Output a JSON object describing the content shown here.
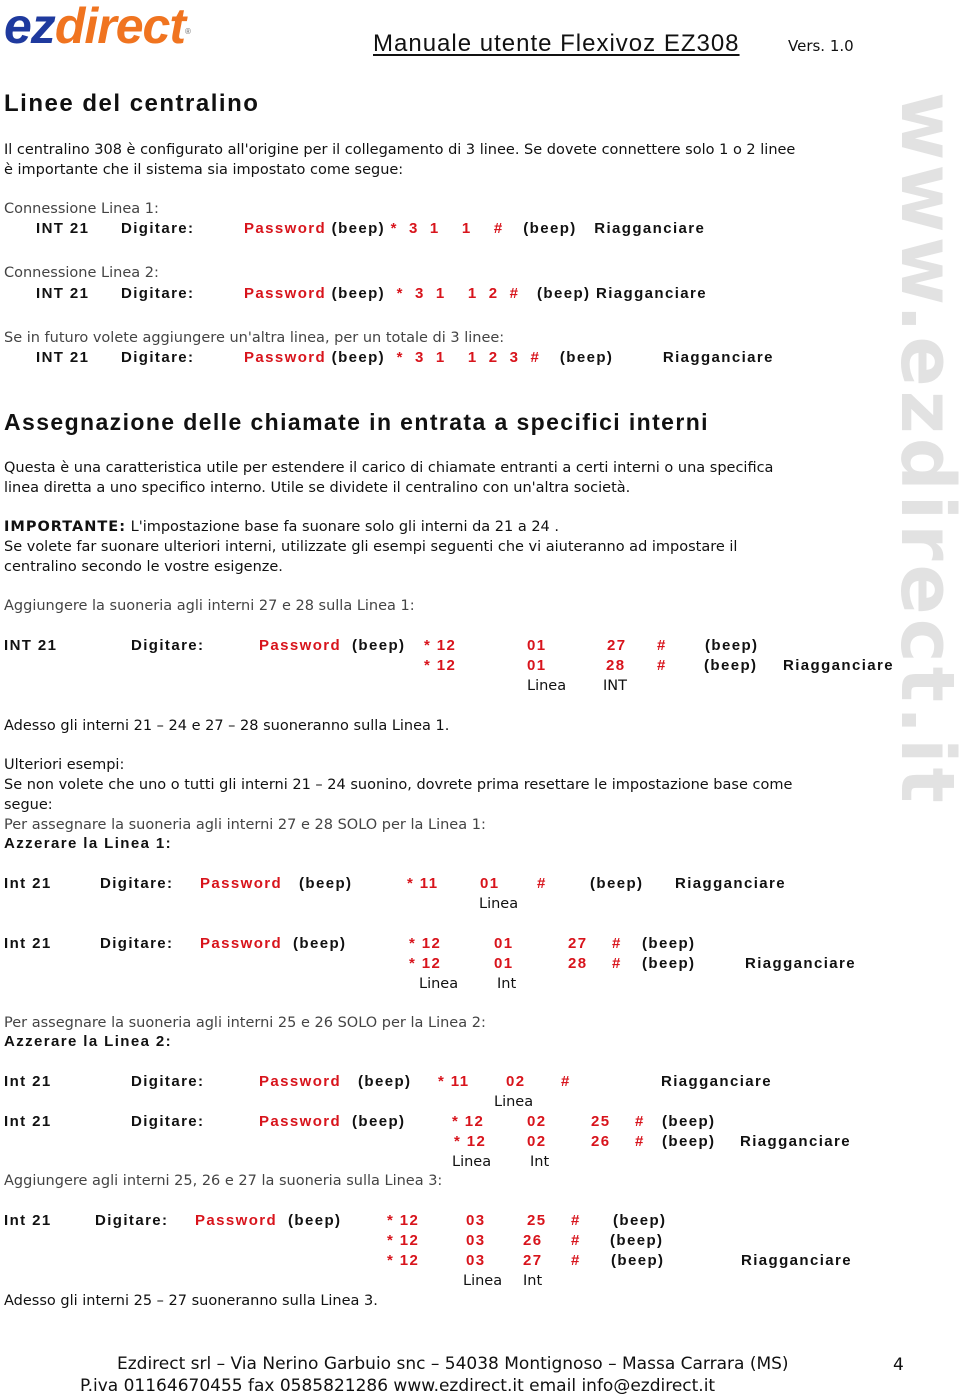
{
  "header": {
    "logo_part1": "ez",
    "logo_part2": "direct",
    "logo_reg": "®",
    "title": "Manuale utente Flexivoz EZ308",
    "version": "Vers. 1.0"
  },
  "watermark": "www.ezdirect.it",
  "section1": {
    "heading": "Linee del centralino",
    "intro_line1": "Il centralino 308 è configurato all'origine per il collegamento di 3 linee. Se dovete connettere solo 1 o 2 linee",
    "intro_line2": "è importante che il sistema sia impostato come segue:",
    "conn1_label": "Connessione Linea 1:",
    "conn2_label": "Connessione Linea 2:",
    "future_label": "Se in futuro volete aggiungere un'altra linea, per un totale di 3 linee:",
    "rows": [
      {
        "int": "INT 21",
        "digitare": "Digitare:",
        "password": "Password",
        "beep1": "(beep)",
        "code": "*  3  1    1    #",
        "beep2": "(beep)",
        "end": "Riagganciare"
      },
      {
        "int": "INT 21",
        "digitare": "Digitare:",
        "password": "Password",
        "beep1": "(beep)",
        "code": "*  3  1    1  2  #",
        "beep2": "(beep)",
        "end": "Riagganciare"
      },
      {
        "int": "INT 21",
        "digitare": "Digitare:",
        "password": "Password",
        "beep1": "(beep)",
        "code": "*  3  1    1  2  3  #",
        "beep2": "(beep)",
        "end": "Riagganciare"
      }
    ]
  },
  "section2": {
    "heading": "Assegnazione delle chiamate in entrata a specifici interni",
    "para1_line1": "Questa è una caratteristica utile per estendere il carico di chiamate entranti a certi interni o una specifica",
    "para1_line2": "linea diretta a uno specifico interno. Utile se dividete il centralino con un'altra società.",
    "important_label": "IMPORTANTE:",
    "important_text": " L'impostazione base fa suonare solo gli interni da 21 a 24 .",
    "para2_line1": "Se volete far suonare ulteriori interni, utilizzate gli esempi seguenti che vi aiuteranno ad impostare il",
    "para2_line2": "centralino secondo le vostre esigenze.",
    "example1_label": "Aggiungere la suoneria agli interni 27 e 28 sulla Linea 1:",
    "example1": {
      "int": "INT 21",
      "digitare": "Digitare:",
      "password": "Password",
      "beep": "(beep)",
      "lines": [
        {
          "cmd": "* 12",
          "linea": "01",
          "int": "27",
          "hash": "#",
          "beep": "(beep)",
          "end": ""
        },
        {
          "cmd": "* 12",
          "linea": "01",
          "int": "28",
          "hash": "#",
          "beep": "(beep)",
          "end": "Riagganciare"
        }
      ],
      "col_linea": "Linea",
      "col_int": "INT"
    },
    "example1_result": "Adesso gli interni 21 – 24 e 27 – 28 suoneranno sulla Linea 1.",
    "more_label": "Ulteriori esempi:",
    "more_line1": "Se non volete che uno o tutti gli interni 21 – 24 suonino, dovrete prima resettare le impostazione base come",
    "more_line2": "segue:",
    "assign1_label": "Per assegnare la suoneria agli interni 27 e 28 SOLO per la Linea 1:",
    "reset1_label": "Azzerare la Linea 1:",
    "reset1": {
      "int": "Int 21",
      "digitare": "Digitare:",
      "password": "Password",
      "beep": "(beep)",
      "cmd": "* 11",
      "linea": "01",
      "hash": "#",
      "beep2": "(beep)",
      "end": "Riagganciare",
      "col_linea": "Linea"
    },
    "assign1": {
      "int": "Int 21",
      "digitare": "Digitare:",
      "password": "Password",
      "beep": "(beep)",
      "lines": [
        {
          "cmd": "* 12",
          "linea": "01",
          "int": "27",
          "hash": "#",
          "beep": "(beep)",
          "end": ""
        },
        {
          "cmd": "* 12",
          "linea": "01",
          "int": "28",
          "hash": "#",
          "beep": "(beep)",
          "end": "Riagganciare"
        }
      ],
      "col_linea": "Linea",
      "col_int": "Int"
    },
    "assign2_label": "Per assegnare la suoneria agli interni 25 e 26 SOLO per la Linea 2:",
    "reset2_label": "Azzerare la Linea 2:",
    "reset2": {
      "int": "Int 21",
      "digitare": "Digitare:",
      "password": "Password",
      "beep": "(beep)",
      "cmd": "* 11",
      "linea": "02",
      "hash": "#",
      "end": "Riagganciare",
      "col_linea": "Linea"
    },
    "assign2": {
      "int": "Int 21",
      "digitare": "Digitare:",
      "password": "Password",
      "beep": "(beep)",
      "lines": [
        {
          "cmd": "* 12",
          "linea": "02",
          "int": "25",
          "hash": "#",
          "beep": "(beep)",
          "end": ""
        },
        {
          "cmd": "* 12",
          "linea": "02",
          "int": "26",
          "hash": "#",
          "beep": "(beep)",
          "end": "Riagganciare"
        }
      ],
      "col_linea": "Linea",
      "col_int": "Int"
    },
    "assign3_label": "Aggiungere agli interni 25, 26 e 27 la suoneria sulla Linea 3:",
    "assign3": {
      "int": "Int 21",
      "digitare": "Digitare:",
      "password": "Password",
      "beep": "(beep)",
      "lines": [
        {
          "cmd": "* 12",
          "linea": "03",
          "int": "25",
          "hash": "#",
          "beep": "(beep)",
          "end": ""
        },
        {
          "cmd": "* 12",
          "linea": "03",
          "int": "26",
          "hash": "#",
          "beep": "(beep)",
          "end": ""
        },
        {
          "cmd": "* 12",
          "linea": "03",
          "int": "27",
          "hash": "#",
          "beep": "(beep)",
          "end": "Riagganciare"
        }
      ],
      "col_linea": "Linea",
      "col_int": "Int"
    },
    "assign3_result": "Adesso gli interni 25 – 27 suoneranno sulla Linea 3."
  },
  "footer": {
    "line1": "Ezdirect srl – Via Nerino Garbuio snc – 54038 Montignoso – Massa Carrara (MS)",
    "line2": "P.iva 01164670455  fax 0585821286  www.ezdirect.it  email info@ezdirect.it",
    "page_number": "4"
  },
  "colors": {
    "accent_red": "#d8141c",
    "logo_blue": "#1f3a9e",
    "logo_orange": "#f07420",
    "watermark_gray": "#e2e2e2"
  }
}
